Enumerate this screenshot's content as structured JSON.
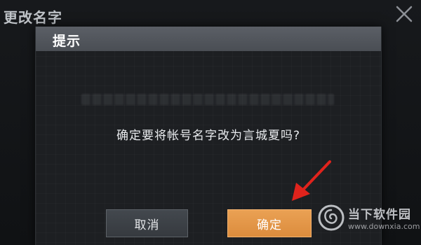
{
  "page": {
    "title": "更改名字"
  },
  "dialog": {
    "title": "提示",
    "message": "确定要将帐号名字改为言城夏吗?",
    "cancel_label": "取消",
    "confirm_label": "确定"
  },
  "watermark": {
    "name": "当下软件园",
    "url": "www.downxia.com"
  },
  "icons": {
    "close": "close-icon",
    "arrow": "red-arrow-annotation",
    "logo": "downxia-logo"
  },
  "colors": {
    "confirm_button": "#e39547",
    "cancel_button": "#3d4146",
    "dialog_header": "#53575d",
    "annotation_arrow": "#e0231c"
  }
}
